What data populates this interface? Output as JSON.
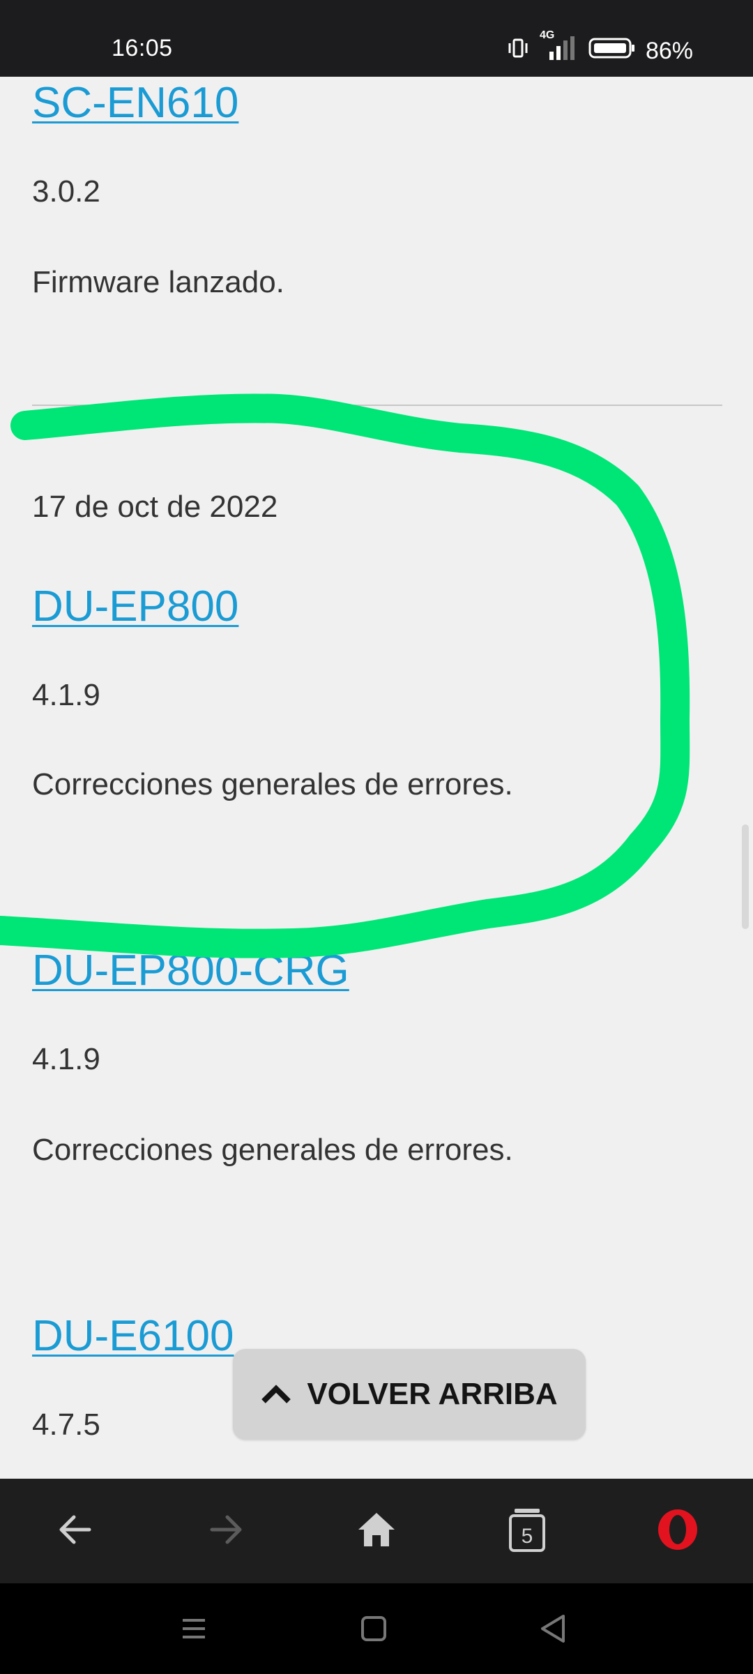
{
  "status_bar": {
    "time": "16:05",
    "network": "4G",
    "battery": "86%"
  },
  "entries": [
    {
      "title": "SC-EN610",
      "version": "3.0.2",
      "description": "Firmware lanzado."
    },
    {
      "date": "17 de oct de 2022",
      "title": "DU-EP800",
      "version": "4.1.9",
      "description": "Correcciones generales de errores."
    },
    {
      "title": "DU-EP800-CRG",
      "version": "4.1.9",
      "description": "Correcciones generales de errores."
    },
    {
      "title": "DU-E6100",
      "version": "4.7.5"
    }
  ],
  "back_to_top": {
    "label": "VOLVER ARRIBA",
    "icon": "chevron-up-icon"
  },
  "browser_nav": {
    "tab_count": "5",
    "icons": [
      "back-arrow-icon",
      "forward-arrow-icon",
      "home-icon",
      "tabs-icon",
      "opera-logo-icon"
    ]
  },
  "system_nav": {
    "icons": [
      "menu-icon",
      "home-square-icon",
      "back-triangle-icon"
    ]
  },
  "colors": {
    "link": "#1a9bd4",
    "highlight": "#00e676",
    "background": "#f0f0f0",
    "opera_red": "#e2131f"
  }
}
